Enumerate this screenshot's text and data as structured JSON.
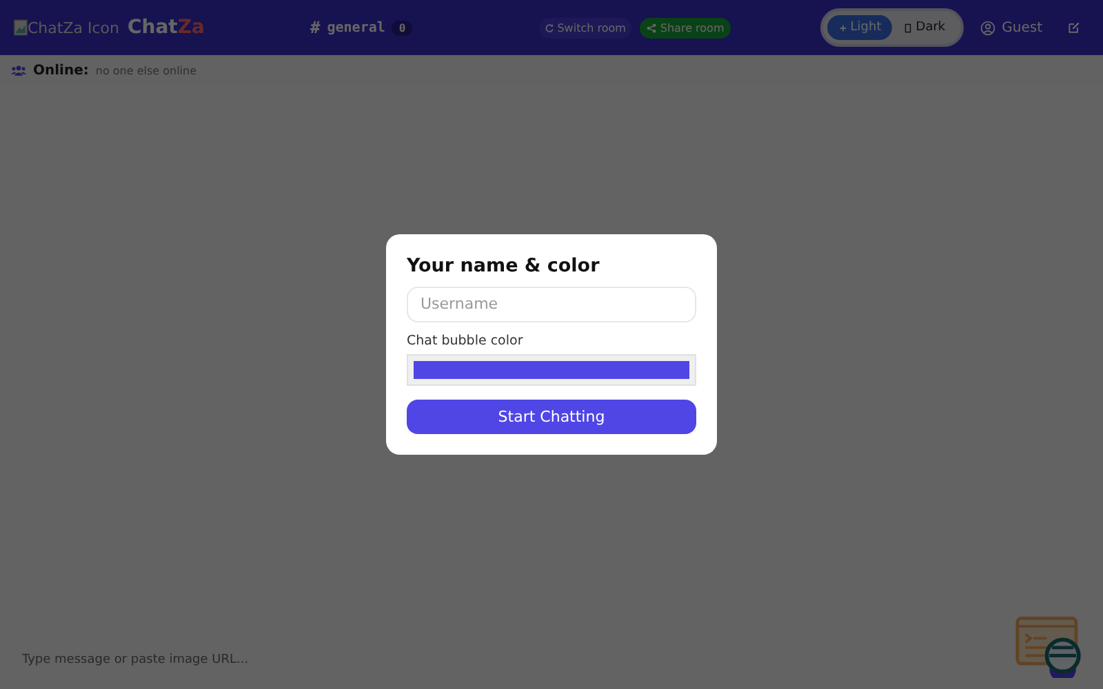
{
  "header": {
    "logo_alt": "ChatZa Icon",
    "brand": [
      "Chat",
      "Za"
    ],
    "room": {
      "hash": "#",
      "name": "general",
      "count": "0"
    },
    "switch_room": "Switch room",
    "share_room": "Share room",
    "theme": [
      {
        "label": "Light",
        "selected": true
      },
      {
        "label": "Dark",
        "selected": false
      }
    ],
    "user": "Guest"
  },
  "online": {
    "label": "Online:",
    "value": "no one else online"
  },
  "composer": {
    "placeholder": "Type message or paste image URL..."
  },
  "dialog": {
    "title": "Your name & color",
    "name_field": {
      "placeholder": "Username"
    },
    "color_label": "Chat bubble color",
    "color": "#4f46e5",
    "button": "Start Chatting"
  }
}
